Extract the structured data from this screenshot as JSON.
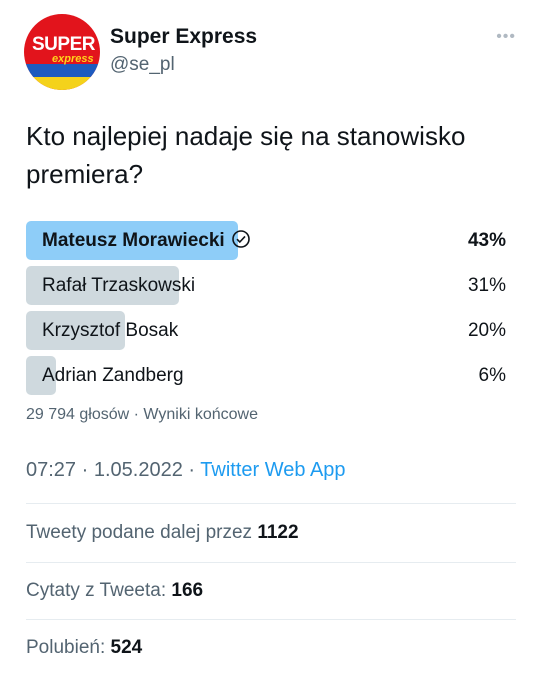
{
  "account": {
    "name": "Super Express",
    "handle": "@se_pl",
    "avatar_text_top": "SUPER",
    "avatar_text_bottom": "express",
    "more_icon": "more-dots-icon"
  },
  "tweet": {
    "text": "Kto najlepiej nadaje się na stanowisko premiera?"
  },
  "poll": {
    "options": [
      {
        "label": "Mateusz Morawiecki",
        "percent_label": "43%",
        "percent": 43,
        "winner": true
      },
      {
        "label": "Rafał Trzaskowski",
        "percent_label": "31%",
        "percent": 31,
        "winner": false
      },
      {
        "label": "Krzysztof Bosak",
        "percent_label": "20%",
        "percent": 20,
        "winner": false
      },
      {
        "label": "Adrian Zandberg",
        "percent_label": "6%",
        "percent": 6,
        "winner": false
      }
    ],
    "votes": "29 794 głosów",
    "separator": "·",
    "status": "Wyniki końcowe",
    "winner_color": "#8ecdf8",
    "bar_color": "#cfd9de"
  },
  "timestamp": {
    "time": "07:27",
    "date": "1.05.2022",
    "source": "Twitter Web App",
    "separator": "·"
  },
  "stats": {
    "retweets_label": "Tweety podane dalej przez",
    "retweets_value": "1122",
    "quotes_label": "Cytaty z Tweeta:",
    "quotes_value": "166",
    "likes_label": "Polubień:",
    "likes_value": "524"
  },
  "colors": {
    "link": "#1d9bf0",
    "secondary_text": "#536471",
    "brand_red": "#e2141c"
  }
}
